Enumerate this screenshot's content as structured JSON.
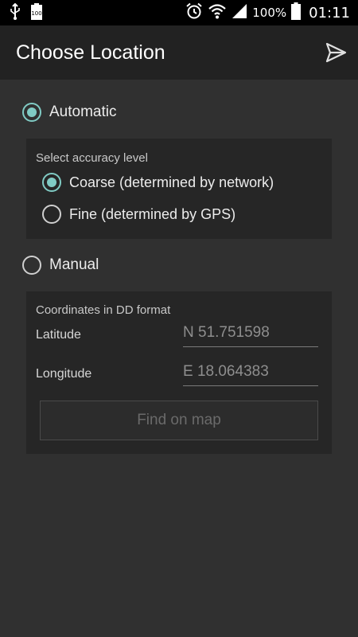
{
  "status_bar": {
    "battery_text": "100",
    "battery_percent": "100%",
    "time": "01:11",
    "icons": [
      "usb-icon",
      "battery-full-icon",
      "alarm-icon",
      "wifi-icon",
      "signal-icon",
      "battery-icon"
    ]
  },
  "action_bar": {
    "title": "Choose Location",
    "send_icon": "send-icon"
  },
  "automatic": {
    "label": "Automatic",
    "selected": true,
    "accuracy_caption": "Select accuracy level",
    "options": [
      {
        "label": "Coarse (determined by network)",
        "selected": true
      },
      {
        "label": "Fine (determined by GPS)",
        "selected": false
      }
    ]
  },
  "manual": {
    "label": "Manual",
    "selected": false,
    "coords_caption": "Coordinates in DD format",
    "latitude_label": "Latitude",
    "latitude_placeholder": "N 51.751598",
    "longitude_label": "Longitude",
    "longitude_placeholder": "E 18.064383",
    "find_button": "Find on map"
  },
  "colors": {
    "accent": "#80cbc4",
    "background": "#303030",
    "panel": "#262626",
    "action_bar": "#222222"
  }
}
